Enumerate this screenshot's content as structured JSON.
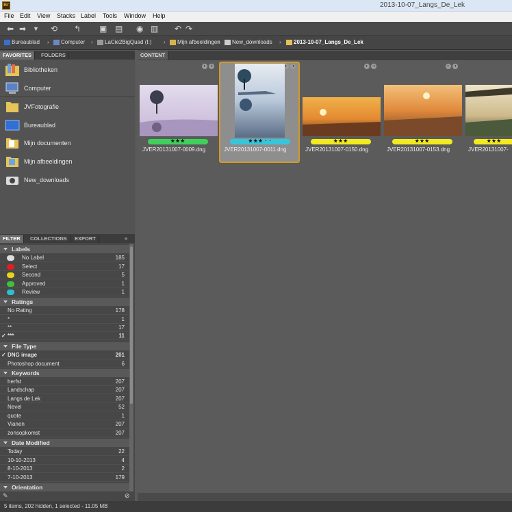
{
  "window": {
    "title": "2013-10-07_Langs_De_Lek",
    "app_icon": "Br"
  },
  "menu": [
    "File",
    "Edit",
    "View",
    "Stacks",
    "Label",
    "Tools",
    "Window",
    "Help"
  ],
  "path": {
    "crumbs": [
      "Bureaublad",
      "Computer",
      "LaCie2BigQuad (I:)",
      "Mijn afbeeldingen",
      "New_downloads"
    ],
    "current": "2013-10-07_Langs_De_Lek"
  },
  "left": {
    "tabs": [
      "FAVORITES",
      "FOLDERS"
    ],
    "favorites": [
      "Bibliotheken",
      "Computer",
      "JVFotografie",
      "Bureaublad",
      "Mijn documenten",
      "Mijn afbeeldingen",
      "New_downloads"
    ],
    "filter_tabs": [
      "FILTER",
      "COLLECTIONS",
      "EXPORT"
    ]
  },
  "filter": {
    "labels_title": "Labels",
    "labels": [
      {
        "name": "No Label",
        "count": "185",
        "color": "#dddddd"
      },
      {
        "name": "Select",
        "count": "17",
        "color": "#e02020"
      },
      {
        "name": "Second",
        "count": "5",
        "color": "#e8d21c"
      },
      {
        "name": "Approved",
        "count": "1",
        "color": "#3fc23a"
      },
      {
        "name": "Review",
        "count": "1",
        "color": "#2dbfd0"
      }
    ],
    "ratings_title": "Ratings",
    "ratings": [
      {
        "name": "No Rating",
        "count": "178"
      },
      {
        "name": "*",
        "count": "1"
      },
      {
        "name": "**",
        "count": "17"
      },
      {
        "name": "***",
        "count": "11",
        "checked": true
      }
    ],
    "filetype_title": "File Type",
    "filetypes": [
      {
        "name": "DNG image",
        "count": "201",
        "checked": true
      },
      {
        "name": "Photoshop document",
        "count": "6"
      }
    ],
    "keywords_title": "Keywords",
    "keywords": [
      {
        "name": "herfst",
        "count": "207"
      },
      {
        "name": "Landschap",
        "count": "207"
      },
      {
        "name": "Langs de Lek",
        "count": "207"
      },
      {
        "name": "Nevel",
        "count": "52"
      },
      {
        "name": "quote",
        "count": "1"
      },
      {
        "name": "Vianen",
        "count": "207"
      },
      {
        "name": "zonsopkomst",
        "count": "207"
      }
    ],
    "date_title": "Date Modified",
    "dates": [
      {
        "name": "Today",
        "count": "22"
      },
      {
        "name": "10-10-2013",
        "count": "4"
      },
      {
        "name": "8-10-2013",
        "count": "2"
      },
      {
        "name": "7-10-2013",
        "count": "179"
      }
    ],
    "orientation_title": "Orientation"
  },
  "content": {
    "tab": "CONTENT",
    "items": [
      {
        "file": "JVER20131007-0009.dng",
        "stars": "★★★",
        "label_color": "#3fd15a"
      },
      {
        "file": "JVER20131007-0011.dng",
        "stars": "★★★ · ·",
        "label_color": "#35c6dc"
      },
      {
        "file": "JVER20131007-0150.dng",
        "stars": "★★★",
        "label_color": "#f2ea1e"
      },
      {
        "file": "JVER20131007-0153.dng",
        "stars": "★★★",
        "label_color": "#f2ea1e"
      },
      {
        "file": "JVER20131007-",
        "stars": "★★★",
        "label_color": "#f2ea1e"
      }
    ]
  },
  "status": "5 items, 202 hidden, 1 selected - 11.05 MB"
}
